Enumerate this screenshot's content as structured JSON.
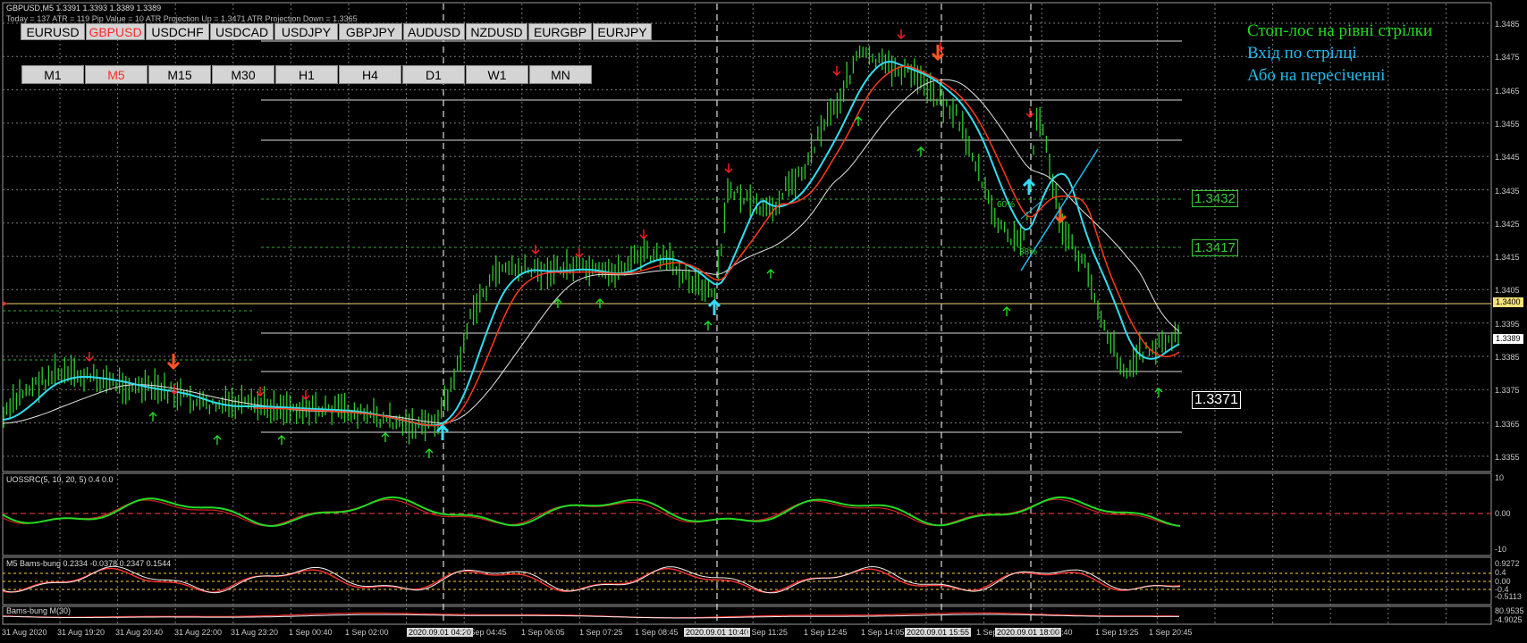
{
  "header": {
    "line1": "GBPUSD,M5  1.3391 1.3393 1.3389 1.3389",
    "line2": "Today = 137    ATR = 119    Pip Value = 10    ATR Projection Up = 1.3471    ATR Projection Down = 1.3365"
  },
  "symbols": [
    {
      "label": "EURUSD",
      "active": false
    },
    {
      "label": "GBPUSD",
      "active": true
    },
    {
      "label": "USDCHF",
      "active": false
    },
    {
      "label": "USDCAD",
      "active": false
    },
    {
      "label": "USDJPY",
      "active": false
    },
    {
      "label": "GBPJPY",
      "active": false
    },
    {
      "label": "AUDUSD",
      "active": false
    },
    {
      "label": "NZDUSD",
      "active": false
    },
    {
      "label": "EURGBP",
      "active": false
    },
    {
      "label": "EURJPY",
      "active": false
    }
  ],
  "timeframes": [
    {
      "label": "M1",
      "active": false
    },
    {
      "label": "M5",
      "active": true
    },
    {
      "label": "M15",
      "active": false
    },
    {
      "label": "M30",
      "active": false
    },
    {
      "label": "H1",
      "active": false
    },
    {
      "label": "H4",
      "active": false
    },
    {
      "label": "D1",
      "active": false
    },
    {
      "label": "W1",
      "active": false
    },
    {
      "label": "MN",
      "active": false
    }
  ],
  "annotations": [
    {
      "text": "Стоп-лос на рівні стрілки",
      "color": "#22dd22"
    },
    {
      "text": "Вхід по стрілці",
      "color": "#22bbee"
    },
    {
      "text": "Або на пересіченні",
      "color": "#22bbee"
    }
  ],
  "levels": {
    "level_1432": "1.3432",
    "level_1417": "1.3417",
    "level_1371": "1.3371",
    "fib_60": "60%",
    "fib_38": "38%"
  },
  "price_axis": {
    "labels": [
      "1.3485",
      "1.3475",
      "1.3465",
      "1.3455",
      "1.3445",
      "1.3435",
      "1.3425",
      "1.3415",
      "1.3405",
      "1.3395",
      "1.3385",
      "1.3375",
      "1.3365",
      "1.3355"
    ],
    "current_price": "1.3389",
    "highlight_price": "1.3400"
  },
  "indicators": {
    "uossrc": {
      "title": "UOSSRC(5, 10, 20, 5) 0.4 0.0",
      "axis": [
        "10",
        "0.00",
        "-10"
      ]
    },
    "bams": {
      "title": "M5  Bams-bung  0.2334 -0.0378 0.2347 0.1544",
      "axis": [
        "0.9272",
        "0.4",
        "0.00",
        "-0.4",
        "-0.5113"
      ]
    },
    "bams_m30": {
      "title": "Bams-bung M(30)",
      "axis": [
        "80.9535",
        "-4.9025"
      ]
    }
  },
  "time_axis": [
    {
      "label": "31 Aug 2020",
      "hl": false
    },
    {
      "label": "31 Aug 19:20",
      "hl": false
    },
    {
      "label": "31 Aug 20:40",
      "hl": false
    },
    {
      "label": "31 Aug 22:00",
      "hl": false
    },
    {
      "label": "31 Aug 23:20",
      "hl": false
    },
    {
      "label": "1 Sep 00:40",
      "hl": false
    },
    {
      "label": "1 Sep 02:00",
      "hl": false
    },
    {
      "label": "2020.09.01 04:20",
      "hl": true
    },
    {
      "label": "1 Sep 04:45",
      "hl": false
    },
    {
      "label": "1 Sep 06:05",
      "hl": false
    },
    {
      "label": "1 Sep 07:25",
      "hl": false
    },
    {
      "label": "1 Sep 08:45",
      "hl": false
    },
    {
      "label": "2020.09.01 10:40",
      "hl": true
    },
    {
      "label": "1 Sep 11:25",
      "hl": false
    },
    {
      "label": "1 Sep 12:45",
      "hl": false
    },
    {
      "label": "1 Sep 14:05",
      "hl": false
    },
    {
      "label": "2020.09.01 15:55",
      "hl": true
    },
    {
      "label": "1 Sep 16:45",
      "hl": false
    },
    {
      "label": "2020.09.01 18:00",
      "hl": true
    },
    {
      "label": "18:40",
      "hl": false
    },
    {
      "label": "1 Sep 19:25",
      "hl": false
    },
    {
      "label": "1 Sep 20:45",
      "hl": false
    }
  ],
  "colors": {
    "candles": "#2ecc2e",
    "ma_cyan": "#33ddee",
    "ma_red": "#ff3a1a",
    "ma_white": "#e6e6e6",
    "arrow_up": "#22dd22",
    "arrow_down": "#ff2020",
    "big_up": "#33ddff",
    "big_down": "#ff5522",
    "grid": "#7a7a7a",
    "trendline": "#22bbee"
  }
}
